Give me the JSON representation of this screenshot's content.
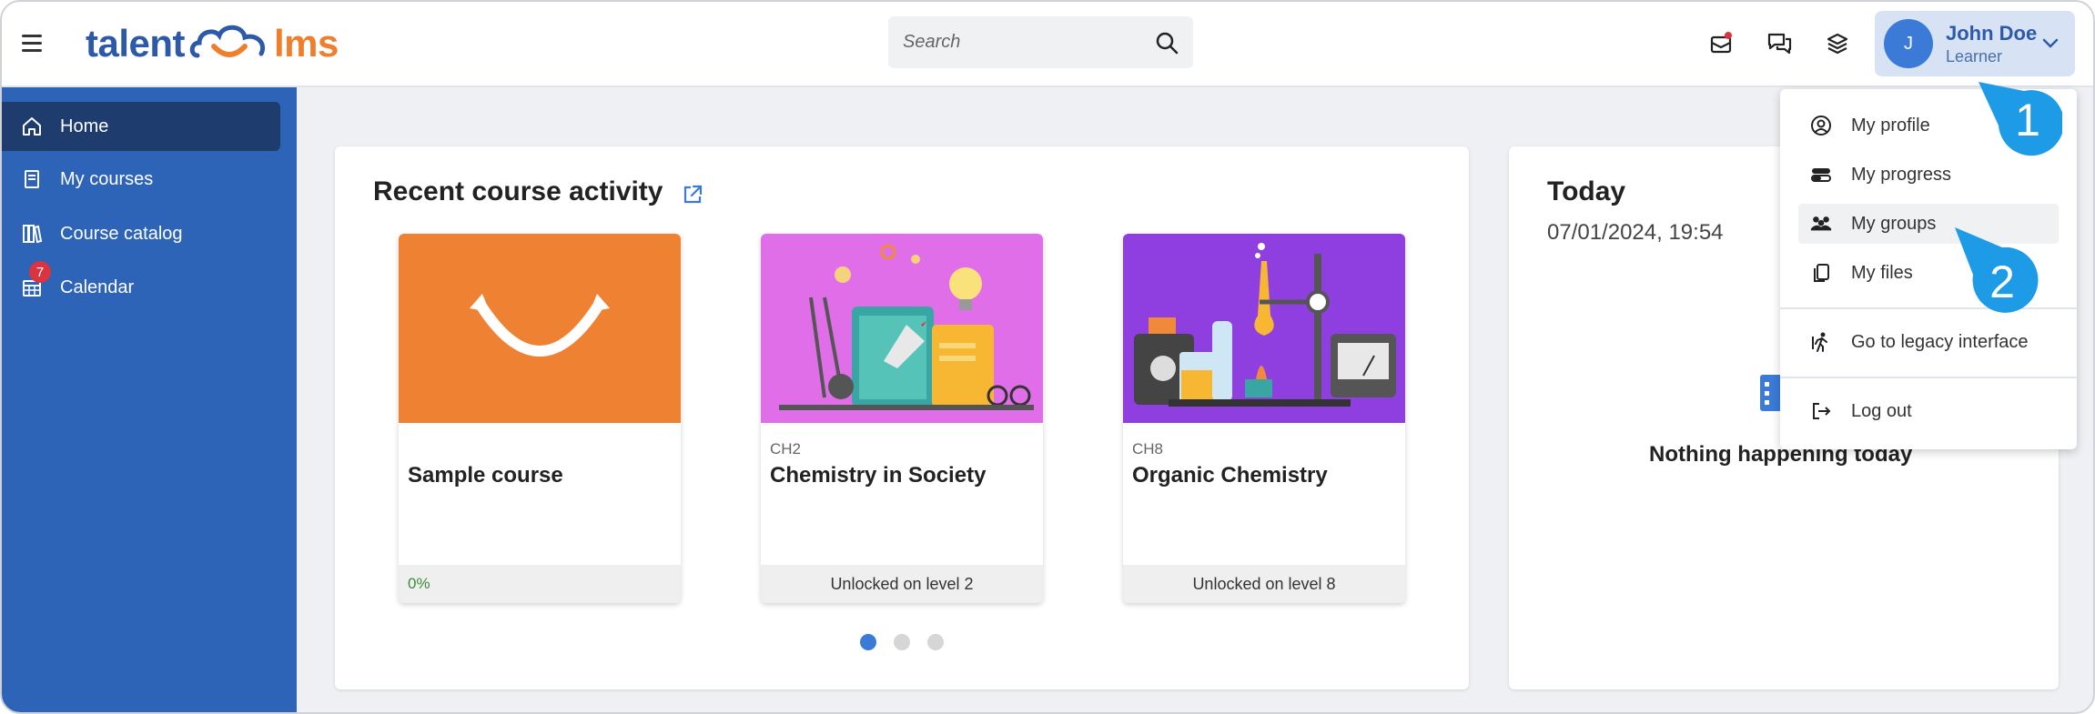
{
  "brand": {
    "part1": "talent",
    "part2": "lms",
    "colors": {
      "blue": "#2d5aa8",
      "orange": "#ee7f2d"
    }
  },
  "search": {
    "placeholder": "Search"
  },
  "header_icons": [
    "mail-notification-icon",
    "chat-icon",
    "coins-stack-icon"
  ],
  "user": {
    "initial": "J",
    "name": "John Doe",
    "role": "Learner"
  },
  "sidebar": {
    "items": [
      {
        "label": "Home",
        "icon": "home-icon",
        "active": true
      },
      {
        "label": "My courses",
        "icon": "book-icon"
      },
      {
        "label": "Course catalog",
        "icon": "books-icon"
      },
      {
        "label": "Calendar",
        "icon": "calendar-icon",
        "badge": "7"
      }
    ]
  },
  "recent": {
    "title": "Recent course activity",
    "courses": [
      {
        "code": "",
        "title": "Sample course",
        "footer": "0%"
      },
      {
        "code": "CH2",
        "title": "Chemistry in Society",
        "footer": "Unlocked on level 2"
      },
      {
        "code": "CH8",
        "title": "Organic Chemistry",
        "footer": "Unlocked on level 8"
      }
    ],
    "pager": {
      "pages": 3,
      "current": 1
    }
  },
  "today": {
    "title": "Today",
    "datetime": "07/01/2024, 19:54",
    "empty_text": "Nothing happening today"
  },
  "dropdown": {
    "items": [
      {
        "label": "My profile",
        "icon": "user-circle-icon"
      },
      {
        "label": "My progress",
        "icon": "progress-icon"
      },
      {
        "label": "My groups",
        "icon": "users-icon"
      },
      {
        "label": "My files",
        "icon": "files-icon"
      },
      {
        "label": "Go to legacy interface",
        "icon": "legacy-icon"
      },
      {
        "label": "Log out",
        "icon": "logout-icon"
      }
    ]
  },
  "steps": [
    "1",
    "2"
  ]
}
